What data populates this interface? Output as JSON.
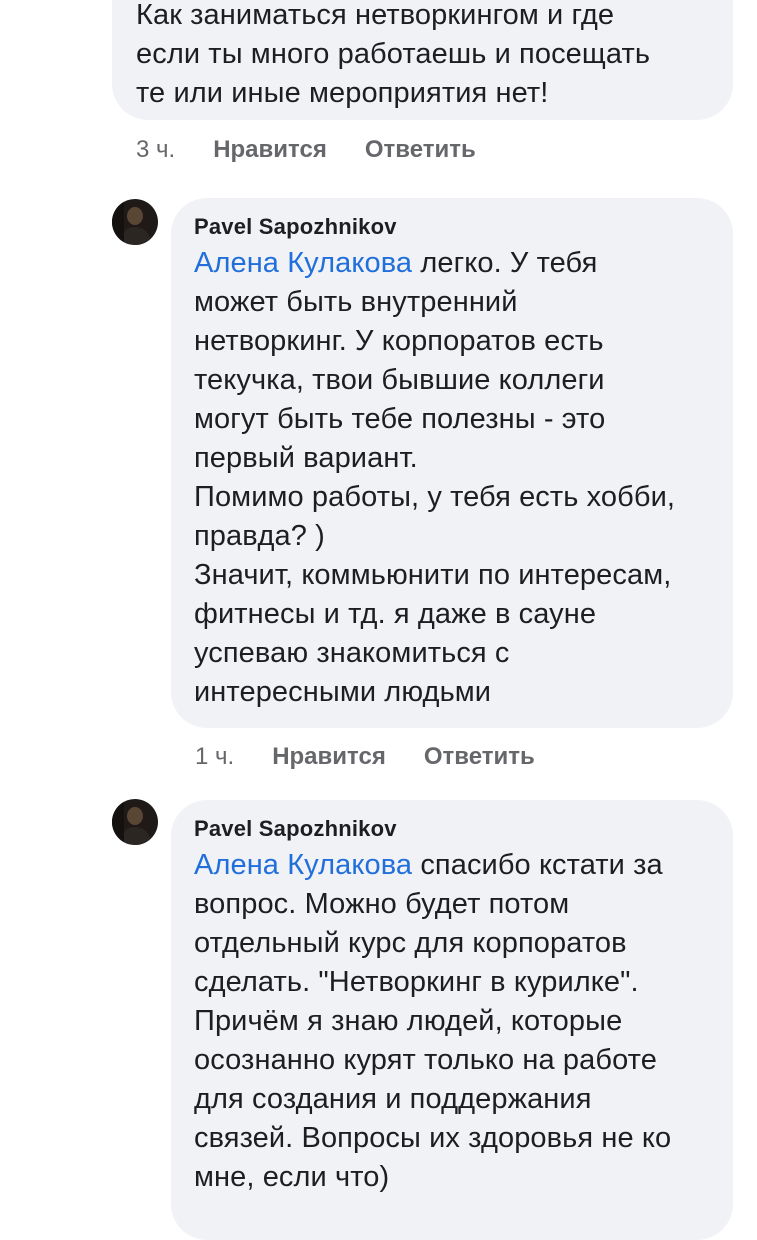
{
  "comments": [
    {
      "text": "Как заниматься нетворкингом и где\nесли ты много работаешь и посещать\nте или иные мероприятия нет!",
      "time": "3 ч.",
      "like_label": "Нравится",
      "reply_label": "Ответить"
    },
    {
      "author": "Pavel Sapozhnikov",
      "mention": "Алена Кулакова",
      "text": " легко. У тебя\nможет быть внутренний\nнетворкинг. У корпоратов есть\nтекучка, твои бывшие коллеги\nмогут быть тебе полезны - это\nпервый вариант.\nПомимо работы, у тебя есть хобби,\nправда? )\nЗначит, коммьюнити по интересам,\nфитнесы и тд. я даже в сауне\nуспеваю знакомиться с\nинтересными людьми",
      "time": "1 ч.",
      "like_label": "Нравится",
      "reply_label": "Ответить"
    },
    {
      "author": "Pavel Sapozhnikov",
      "mention": "Алена Кулакова",
      "text": " спасибо кстати за\nвопрос. Можно будет потом\nотдельный курс для корпоратов\nсделать. \"Нетворкинг в курилке\".\nПричём я знаю людей, которые\nосознанно курят только на работе\nдля создания и поддержания\nсвязей. Вопросы их здоровья не ко\nмне, если что)"
    }
  ],
  "colors": {
    "bubble": "#f0f2f5",
    "mention": "#216fdb",
    "meta": "#65676b"
  }
}
